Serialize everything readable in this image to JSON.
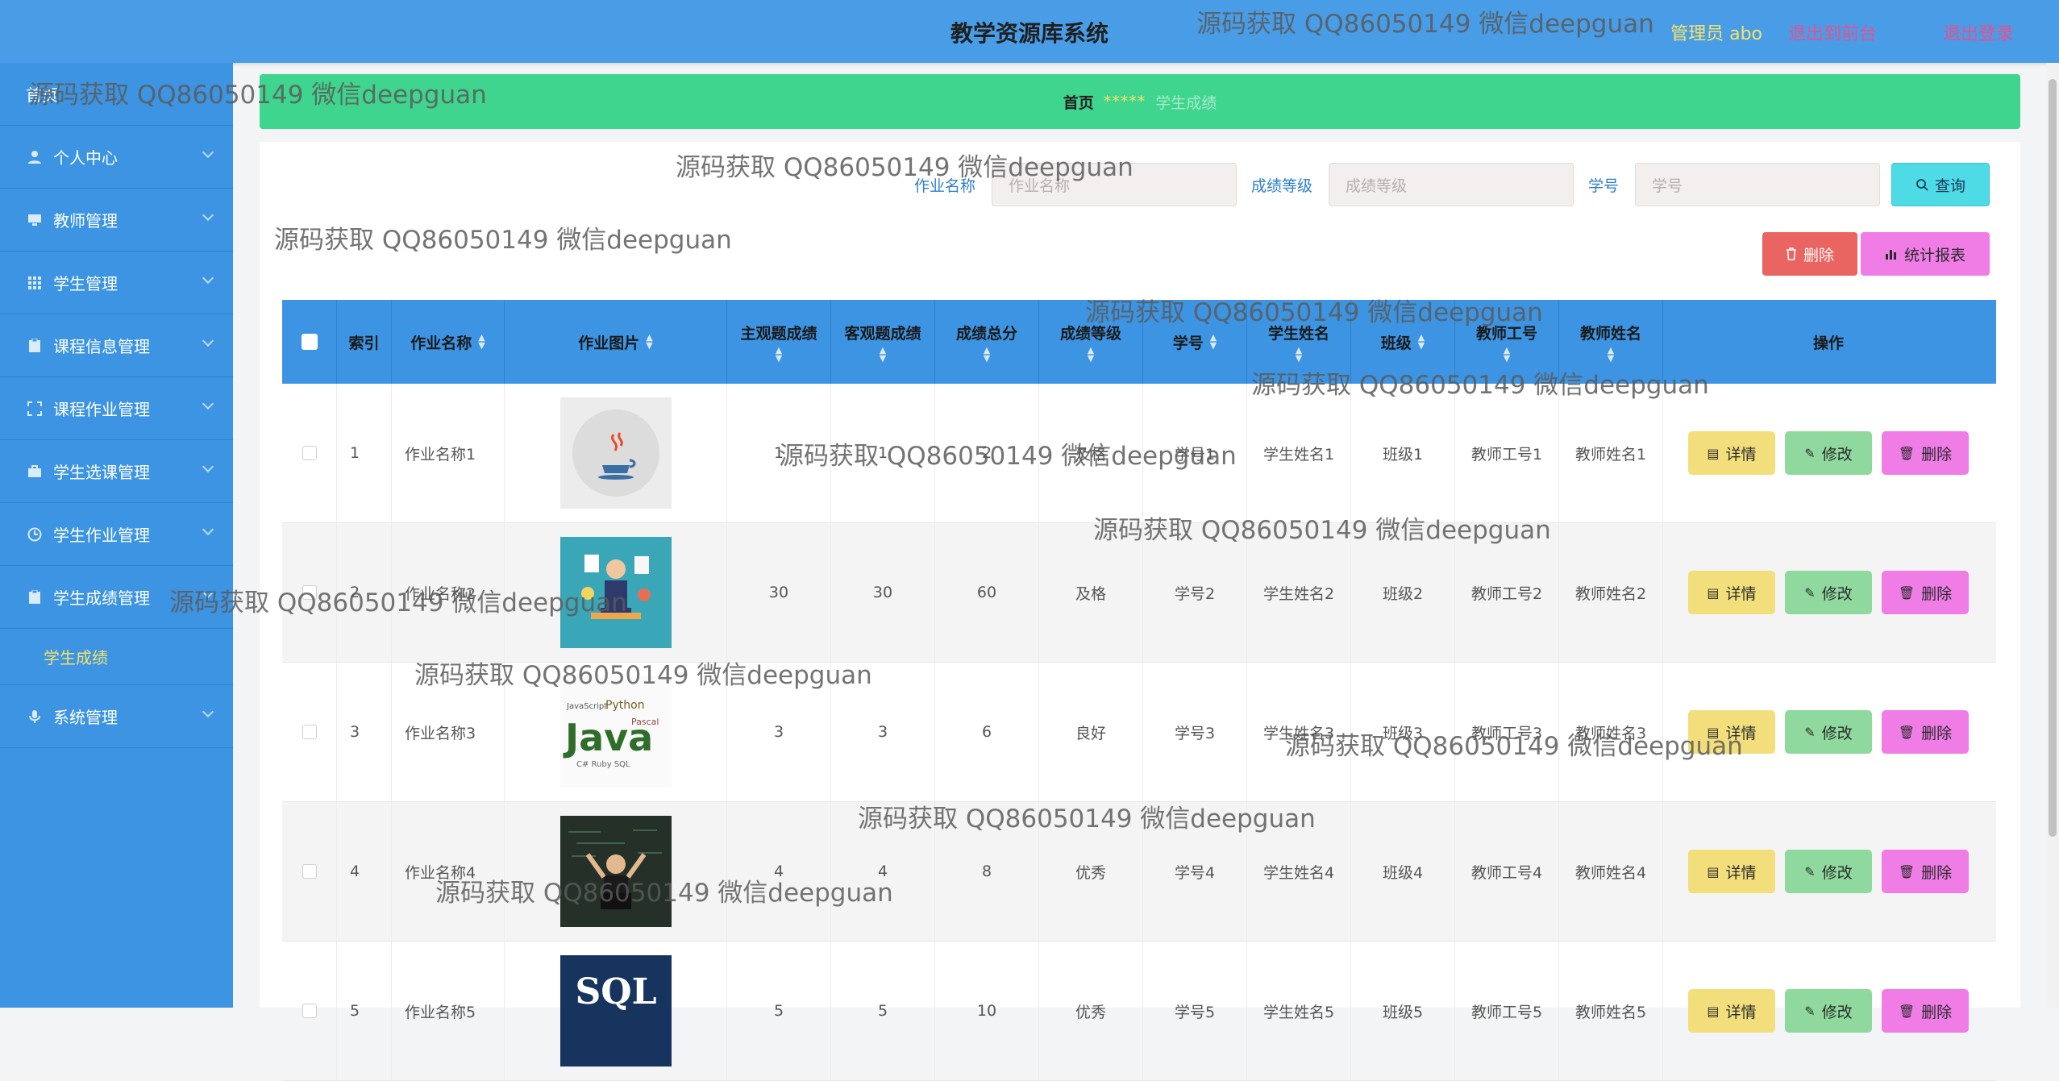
{
  "header": {
    "title": "教学资源库系统",
    "admin_label": "管理员 abo",
    "front_link": "退出到前台",
    "logout_link": "退出登录"
  },
  "sidebar": {
    "items": [
      {
        "label": "首页",
        "icon": "home-icon"
      },
      {
        "label": "个人中心",
        "icon": "user-icon"
      },
      {
        "label": "教师管理",
        "icon": "monitor-icon"
      },
      {
        "label": "学生管理",
        "icon": "grid-icon"
      },
      {
        "label": "课程信息管理",
        "icon": "clipboard-icon"
      },
      {
        "label": "课程作业管理",
        "icon": "expand-icon"
      },
      {
        "label": "学生选课管理",
        "icon": "briefcase-icon"
      },
      {
        "label": "学生作业管理",
        "icon": "clock-icon"
      },
      {
        "label": "学生成绩管理",
        "icon": "clipboard-icon"
      }
    ],
    "sub_item": "学生成绩",
    "last_item": {
      "label": "系统管理",
      "icon": "microphone-icon"
    }
  },
  "breadcrumb": {
    "home": "首页",
    "sep": "*****",
    "current": "学生成绩"
  },
  "search": {
    "fields": [
      {
        "label": "作业名称",
        "placeholder": "作业名称"
      },
      {
        "label": "成绩等级",
        "placeholder": "成绩等级"
      },
      {
        "label": "学号",
        "placeholder": "学号"
      }
    ],
    "query_button": "查询"
  },
  "actions": {
    "delete_button": "删除",
    "report_button": "统计报表"
  },
  "table": {
    "headers": [
      "索引",
      "作业名称",
      "作业图片",
      "主观题成绩",
      "客观题成绩",
      "成绩总分",
      "成绩等级",
      "学号",
      "学生姓名",
      "班级",
      "教师工号",
      "教师姓名",
      "操作"
    ],
    "op_detail": "详情",
    "op_edit": "修改",
    "op_delete": "删除",
    "rows": [
      {
        "index": "1",
        "name": "作业名称1",
        "image": "java-cup-logo",
        "subj": "1",
        "obj": "1",
        "total": "2",
        "grade": "及格",
        "sid": "学号1",
        "sname": "学生姓名1",
        "cls": "班级1",
        "tid": "教师工号1",
        "tname": "教师姓名1"
      },
      {
        "index": "2",
        "name": "作业名称2",
        "image": "developer-illustration",
        "subj": "30",
        "obj": "30",
        "total": "60",
        "grade": "及格",
        "sid": "学号2",
        "sname": "学生姓名2",
        "cls": "班级2",
        "tid": "教师工号2",
        "tname": "教师姓名2"
      },
      {
        "index": "3",
        "name": "作业名称3",
        "image": "java-wordcloud",
        "subj": "3",
        "obj": "3",
        "total": "6",
        "grade": "良好",
        "sid": "学号3",
        "sname": "学生姓名3",
        "cls": "班级3",
        "tid": "教师工号3",
        "tname": "教师姓名3"
      },
      {
        "index": "4",
        "name": "作业名称4",
        "image": "chalkboard-coder",
        "subj": "4",
        "obj": "4",
        "total": "8",
        "grade": "优秀",
        "sid": "学号4",
        "sname": "学生姓名4",
        "cls": "班级4",
        "tid": "教师工号4",
        "tname": "教师姓名4"
      },
      {
        "index": "5",
        "name": "作业名称5",
        "image": "sql-logo",
        "subj": "5",
        "obj": "5",
        "total": "10",
        "grade": "优秀",
        "sid": "学号5",
        "sname": "学生姓名5",
        "cls": "班级5",
        "tid": "教师工号5",
        "tname": "教师姓名5"
      }
    ]
  },
  "watermark": "源码获取 QQ86050149 微信deepguan",
  "colors": {
    "topbar": "#489de6",
    "sidebar": "#3c94e2",
    "breadcrumb": "#3fd58f",
    "query": "#4fdbe6",
    "danger": "#ea6461",
    "pink": "#f07ce6",
    "yellow": "#f2df7c",
    "green": "#8fd99e"
  }
}
